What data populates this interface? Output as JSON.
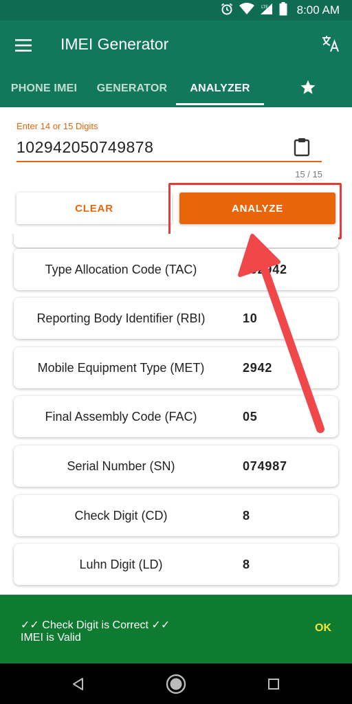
{
  "status_bar": {
    "time": "8:00 AM",
    "icons": [
      "alarm-icon",
      "wifi-icon",
      "lte-signal-icon",
      "battery-icon"
    ]
  },
  "app_bar": {
    "title": "IMEI Generator",
    "menu_icon": "menu-icon",
    "action_icon": "translate-icon"
  },
  "tabs": [
    {
      "label": "PHONE IMEI",
      "active": false
    },
    {
      "label": "GENERATOR",
      "active": false
    },
    {
      "label": "ANALYZER",
      "active": true
    },
    {
      "icon": "star-icon",
      "active": false
    }
  ],
  "input": {
    "label": "Enter 14 or 15 Digits",
    "value": "102942050749878",
    "counter": "15 / 15"
  },
  "buttons": {
    "clear": "CLEAR",
    "analyze": "ANALYZE"
  },
  "results": [
    {
      "label": "Type Allocation Code (TAC)",
      "value": "102942"
    },
    {
      "label": "Reporting Body Identifier (RBI)",
      "value": "10"
    },
    {
      "label": "Mobile Equipment Type (MET)",
      "value": "2942"
    },
    {
      "label": "Final Assembly Code (FAC)",
      "value": "05"
    },
    {
      "label": "Serial Number (SN)",
      "value": "074987"
    },
    {
      "label": "Check Digit (CD)",
      "value": "8"
    },
    {
      "label": "Luhn Digit (LD)",
      "value": "8"
    }
  ],
  "snackbar": {
    "line1": "✓✓ Check Digit is Correct ✓✓",
    "line2": "IMEI is Valid",
    "action": "OK"
  },
  "colors": {
    "primary": "#12785b",
    "status": "#0f6b52",
    "accent": "#e8650a",
    "annotation": "#e53b3b",
    "snackbar": "#0e7b30",
    "snackbar_action": "#f4e73c"
  }
}
